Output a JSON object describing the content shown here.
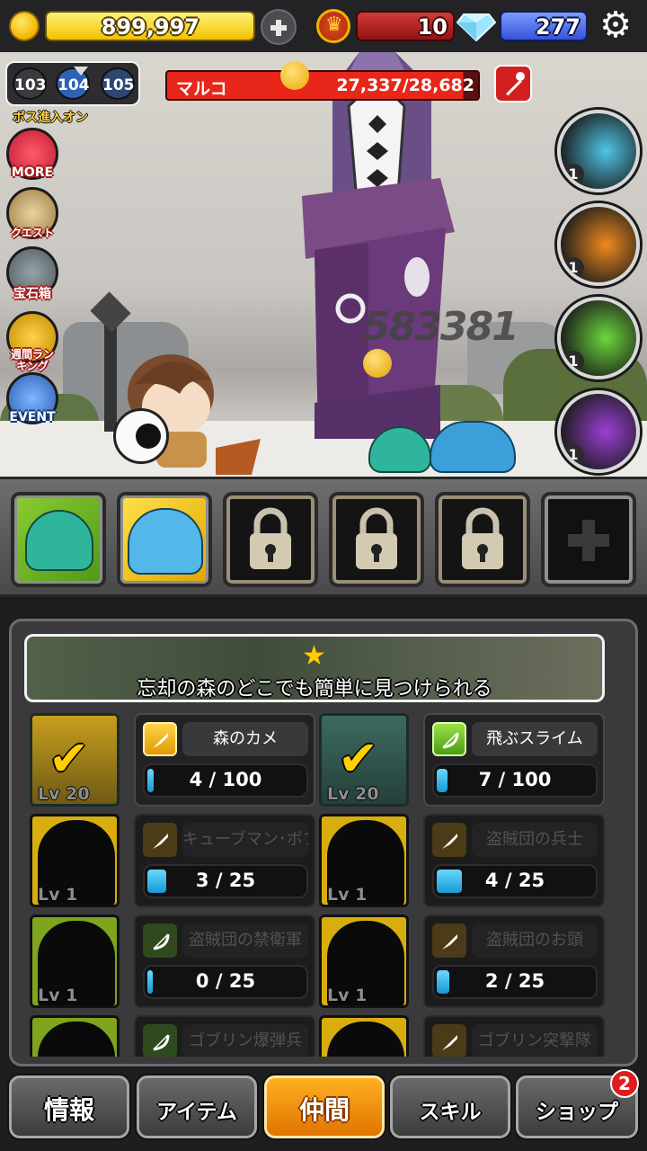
{
  "currency": {
    "gold": "899,997",
    "crowns": "10",
    "diamonds": "277"
  },
  "stage": {
    "prev": "103",
    "current": "104",
    "next": "105",
    "boss_toggle_label": "ボス進入オン"
  },
  "boss": {
    "name": "マルコ",
    "hp_text": "27,337/28,682",
    "hp_fraction": 0.953
  },
  "damage_popup": "583381",
  "side_menu": [
    {
      "label": "MORE",
      "icon": "fox-icon"
    },
    {
      "label": "クエスト",
      "icon": "scroll-icon"
    },
    {
      "label": "宝石箱",
      "icon": "treasure-chest-icon"
    },
    {
      "label": "週間ランキング",
      "icon": "trophy-icon"
    },
    {
      "label": "EVENT",
      "icon": "thumbs-up-icon"
    }
  ],
  "skills": [
    {
      "level": "1",
      "color": "#4fc6e8"
    },
    {
      "level": "1",
      "color": "#f08a1c"
    },
    {
      "level": "1",
      "color": "#6bd83a"
    },
    {
      "level": "1",
      "color": "#9a3fd6"
    }
  ],
  "companion_slots": [
    {
      "state": "filled",
      "frame": "green"
    },
    {
      "state": "filled",
      "frame": "yellow"
    },
    {
      "state": "locked"
    },
    {
      "state": "locked"
    },
    {
      "state": "locked"
    },
    {
      "state": "add"
    }
  ],
  "panel": {
    "banner_text": "忘却の森のどこでも簡単に見つけられる",
    "cards": [
      {
        "name": "森のカメ",
        "level": "Lv 20",
        "progress": "4 / 100",
        "fraction": 0.04,
        "unlocked": true,
        "icon": "gold"
      },
      {
        "name": "飛ぶスライム",
        "level": "Lv 20",
        "progress": "7 / 100",
        "fraction": 0.07,
        "unlocked": true,
        "icon": "lime"
      },
      {
        "name": "キューブマン･ボブ",
        "level": "Lv 1",
        "progress": "3 / 25",
        "fraction": 0.12,
        "unlocked": false,
        "icon": "gold"
      },
      {
        "name": "盗賊団の兵士",
        "level": "Lv 1",
        "progress": "4 / 25",
        "fraction": 0.16,
        "unlocked": false,
        "icon": "gold"
      },
      {
        "name": "盗賊団の禁衛軍",
        "level": "Lv 1",
        "progress": "0 / 25",
        "fraction": 0.0,
        "unlocked": false,
        "icon": "lime"
      },
      {
        "name": "盗賊団のお頭",
        "level": "Lv 1",
        "progress": "2 / 25",
        "fraction": 0.08,
        "unlocked": false,
        "icon": "gold"
      },
      {
        "name": "ゴブリン爆弾兵",
        "level": "",
        "progress": "",
        "fraction": 0,
        "unlocked": false,
        "icon": "lime"
      },
      {
        "name": "ゴブリン突撃隊",
        "level": "",
        "progress": "",
        "fraction": 0,
        "unlocked": false,
        "icon": "gold"
      }
    ]
  },
  "tabs": [
    {
      "label": "情報"
    },
    {
      "label": "アイテム"
    },
    {
      "label": "仲間",
      "active": true
    },
    {
      "label": "スキル"
    },
    {
      "label": "ショップ",
      "badge": "2"
    }
  ]
}
